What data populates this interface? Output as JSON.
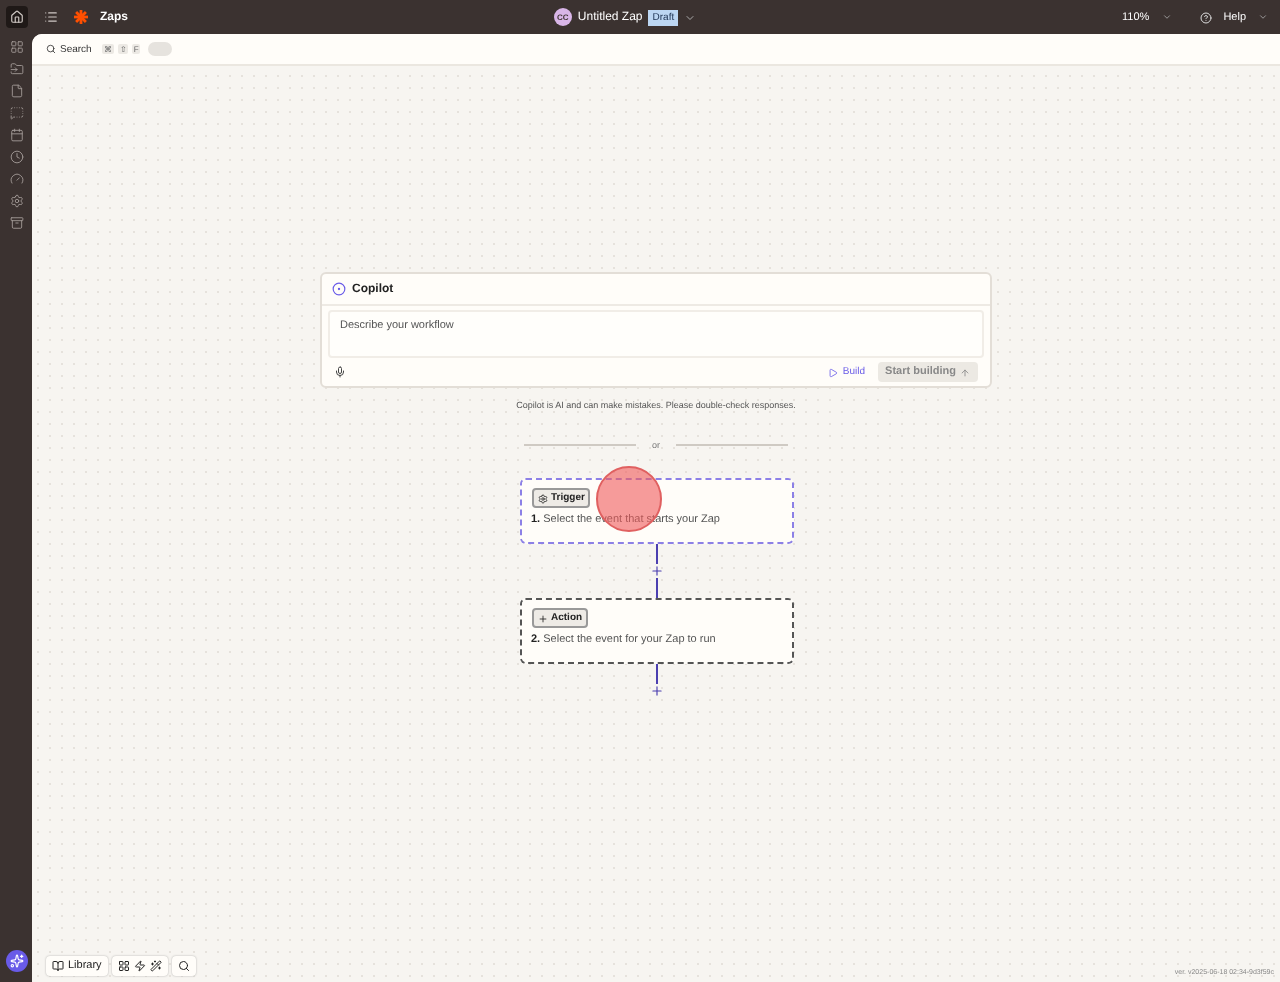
{
  "topbar": {
    "app": "Zaps",
    "avatar": "CC",
    "title": "Untitled Zap",
    "status": "Draft",
    "zoom": "110%",
    "help": "Help"
  },
  "toolbar": {
    "search": "Search",
    "keys": [
      "⌘",
      "⇧",
      "F"
    ],
    "toggle_on": false
  },
  "copilot": {
    "title": "Copilot",
    "placeholder": "Describe your workflow",
    "build": "Build",
    "start": "Start building",
    "disclaimer": "Copilot is AI and can make mistakes. Please double-check responses."
  },
  "divider": "or",
  "steps": [
    {
      "kind": "trigger",
      "badge": "Trigger",
      "number": "1.",
      "text": "Select the event that starts your Zap",
      "selected": true
    },
    {
      "kind": "action",
      "badge": "Action",
      "number": "2.",
      "text": "Select the event for your Zap to run",
      "selected": false
    }
  ],
  "bottom": {
    "library": "Library"
  },
  "version": "ver. v2025-06-18 02:34-9d3f59c"
}
